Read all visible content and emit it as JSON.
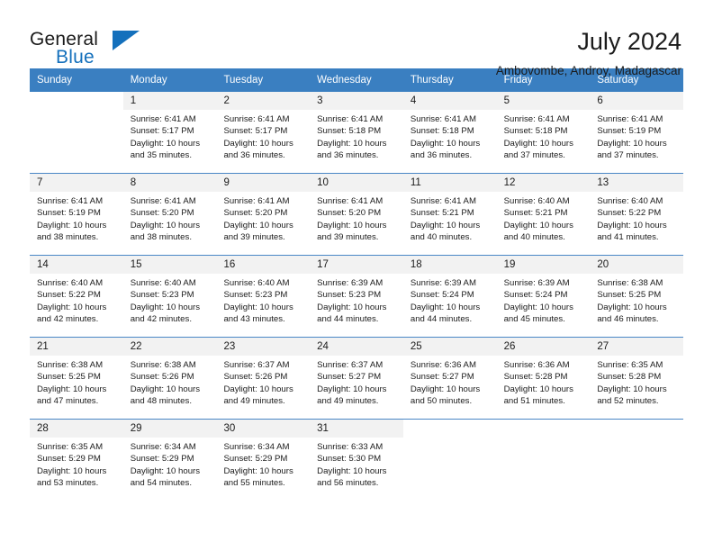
{
  "brand": {
    "name_dark": "General",
    "name_light": "Blue",
    "triangle_color": "#1470bc"
  },
  "header": {
    "title": "July 2024",
    "location": "Ambovombe, Androy, Madagascar"
  },
  "theme": {
    "header_blue": "#3a7fc1",
    "daynum_band": "#f2f2f2",
    "grid_line": "#4a87c6"
  },
  "weekdays": [
    "Sunday",
    "Monday",
    "Tuesday",
    "Wednesday",
    "Thursday",
    "Friday",
    "Saturday"
  ],
  "weeks": [
    [
      {
        "day": "",
        "sunrise": "",
        "sunset": "",
        "daylight1": "",
        "daylight2": ""
      },
      {
        "day": "1",
        "sunrise": "Sunrise: 6:41 AM",
        "sunset": "Sunset: 5:17 PM",
        "daylight1": "Daylight: 10 hours",
        "daylight2": "and 35 minutes."
      },
      {
        "day": "2",
        "sunrise": "Sunrise: 6:41 AM",
        "sunset": "Sunset: 5:17 PM",
        "daylight1": "Daylight: 10 hours",
        "daylight2": "and 36 minutes."
      },
      {
        "day": "3",
        "sunrise": "Sunrise: 6:41 AM",
        "sunset": "Sunset: 5:18 PM",
        "daylight1": "Daylight: 10 hours",
        "daylight2": "and 36 minutes."
      },
      {
        "day": "4",
        "sunrise": "Sunrise: 6:41 AM",
        "sunset": "Sunset: 5:18 PM",
        "daylight1": "Daylight: 10 hours",
        "daylight2": "and 36 minutes."
      },
      {
        "day": "5",
        "sunrise": "Sunrise: 6:41 AM",
        "sunset": "Sunset: 5:18 PM",
        "daylight1": "Daylight: 10 hours",
        "daylight2": "and 37 minutes."
      },
      {
        "day": "6",
        "sunrise": "Sunrise: 6:41 AM",
        "sunset": "Sunset: 5:19 PM",
        "daylight1": "Daylight: 10 hours",
        "daylight2": "and 37 minutes."
      }
    ],
    [
      {
        "day": "7",
        "sunrise": "Sunrise: 6:41 AM",
        "sunset": "Sunset: 5:19 PM",
        "daylight1": "Daylight: 10 hours",
        "daylight2": "and 38 minutes."
      },
      {
        "day": "8",
        "sunrise": "Sunrise: 6:41 AM",
        "sunset": "Sunset: 5:20 PM",
        "daylight1": "Daylight: 10 hours",
        "daylight2": "and 38 minutes."
      },
      {
        "day": "9",
        "sunrise": "Sunrise: 6:41 AM",
        "sunset": "Sunset: 5:20 PM",
        "daylight1": "Daylight: 10 hours",
        "daylight2": "and 39 minutes."
      },
      {
        "day": "10",
        "sunrise": "Sunrise: 6:41 AM",
        "sunset": "Sunset: 5:20 PM",
        "daylight1": "Daylight: 10 hours",
        "daylight2": "and 39 minutes."
      },
      {
        "day": "11",
        "sunrise": "Sunrise: 6:41 AM",
        "sunset": "Sunset: 5:21 PM",
        "daylight1": "Daylight: 10 hours",
        "daylight2": "and 40 minutes."
      },
      {
        "day": "12",
        "sunrise": "Sunrise: 6:40 AM",
        "sunset": "Sunset: 5:21 PM",
        "daylight1": "Daylight: 10 hours",
        "daylight2": "and 40 minutes."
      },
      {
        "day": "13",
        "sunrise": "Sunrise: 6:40 AM",
        "sunset": "Sunset: 5:22 PM",
        "daylight1": "Daylight: 10 hours",
        "daylight2": "and 41 minutes."
      }
    ],
    [
      {
        "day": "14",
        "sunrise": "Sunrise: 6:40 AM",
        "sunset": "Sunset: 5:22 PM",
        "daylight1": "Daylight: 10 hours",
        "daylight2": "and 42 minutes."
      },
      {
        "day": "15",
        "sunrise": "Sunrise: 6:40 AM",
        "sunset": "Sunset: 5:23 PM",
        "daylight1": "Daylight: 10 hours",
        "daylight2": "and 42 minutes."
      },
      {
        "day": "16",
        "sunrise": "Sunrise: 6:40 AM",
        "sunset": "Sunset: 5:23 PM",
        "daylight1": "Daylight: 10 hours",
        "daylight2": "and 43 minutes."
      },
      {
        "day": "17",
        "sunrise": "Sunrise: 6:39 AM",
        "sunset": "Sunset: 5:23 PM",
        "daylight1": "Daylight: 10 hours",
        "daylight2": "and 44 minutes."
      },
      {
        "day": "18",
        "sunrise": "Sunrise: 6:39 AM",
        "sunset": "Sunset: 5:24 PM",
        "daylight1": "Daylight: 10 hours",
        "daylight2": "and 44 minutes."
      },
      {
        "day": "19",
        "sunrise": "Sunrise: 6:39 AM",
        "sunset": "Sunset: 5:24 PM",
        "daylight1": "Daylight: 10 hours",
        "daylight2": "and 45 minutes."
      },
      {
        "day": "20",
        "sunrise": "Sunrise: 6:38 AM",
        "sunset": "Sunset: 5:25 PM",
        "daylight1": "Daylight: 10 hours",
        "daylight2": "and 46 minutes."
      }
    ],
    [
      {
        "day": "21",
        "sunrise": "Sunrise: 6:38 AM",
        "sunset": "Sunset: 5:25 PM",
        "daylight1": "Daylight: 10 hours",
        "daylight2": "and 47 minutes."
      },
      {
        "day": "22",
        "sunrise": "Sunrise: 6:38 AM",
        "sunset": "Sunset: 5:26 PM",
        "daylight1": "Daylight: 10 hours",
        "daylight2": "and 48 minutes."
      },
      {
        "day": "23",
        "sunrise": "Sunrise: 6:37 AM",
        "sunset": "Sunset: 5:26 PM",
        "daylight1": "Daylight: 10 hours",
        "daylight2": "and 49 minutes."
      },
      {
        "day": "24",
        "sunrise": "Sunrise: 6:37 AM",
        "sunset": "Sunset: 5:27 PM",
        "daylight1": "Daylight: 10 hours",
        "daylight2": "and 49 minutes."
      },
      {
        "day": "25",
        "sunrise": "Sunrise: 6:36 AM",
        "sunset": "Sunset: 5:27 PM",
        "daylight1": "Daylight: 10 hours",
        "daylight2": "and 50 minutes."
      },
      {
        "day": "26",
        "sunrise": "Sunrise: 6:36 AM",
        "sunset": "Sunset: 5:28 PM",
        "daylight1": "Daylight: 10 hours",
        "daylight2": "and 51 minutes."
      },
      {
        "day": "27",
        "sunrise": "Sunrise: 6:35 AM",
        "sunset": "Sunset: 5:28 PM",
        "daylight1": "Daylight: 10 hours",
        "daylight2": "and 52 minutes."
      }
    ],
    [
      {
        "day": "28",
        "sunrise": "Sunrise: 6:35 AM",
        "sunset": "Sunset: 5:29 PM",
        "daylight1": "Daylight: 10 hours",
        "daylight2": "and 53 minutes."
      },
      {
        "day": "29",
        "sunrise": "Sunrise: 6:34 AM",
        "sunset": "Sunset: 5:29 PM",
        "daylight1": "Daylight: 10 hours",
        "daylight2": "and 54 minutes."
      },
      {
        "day": "30",
        "sunrise": "Sunrise: 6:34 AM",
        "sunset": "Sunset: 5:29 PM",
        "daylight1": "Daylight: 10 hours",
        "daylight2": "and 55 minutes."
      },
      {
        "day": "31",
        "sunrise": "Sunrise: 6:33 AM",
        "sunset": "Sunset: 5:30 PM",
        "daylight1": "Daylight: 10 hours",
        "daylight2": "and 56 minutes."
      },
      {
        "day": "",
        "sunrise": "",
        "sunset": "",
        "daylight1": "",
        "daylight2": ""
      },
      {
        "day": "",
        "sunrise": "",
        "sunset": "",
        "daylight1": "",
        "daylight2": ""
      },
      {
        "day": "",
        "sunrise": "",
        "sunset": "",
        "daylight1": "",
        "daylight2": ""
      }
    ]
  ]
}
